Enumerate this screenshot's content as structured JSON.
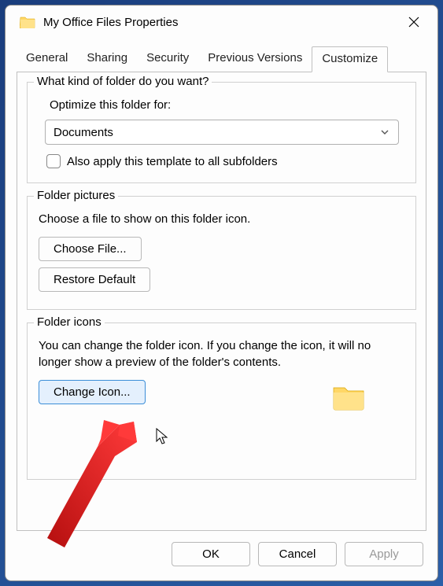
{
  "window": {
    "title": "My Office Files Properties"
  },
  "tabs": {
    "general": "General",
    "sharing": "Sharing",
    "security": "Security",
    "previous": "Previous Versions",
    "customize": "Customize"
  },
  "group_kind": {
    "legend": "What kind of folder do you want?",
    "optimize_label": "Optimize this folder for:",
    "selected": "Documents",
    "checkbox_label": "Also apply this template to all subfolders"
  },
  "group_pictures": {
    "legend": "Folder pictures",
    "desc": "Choose a file to show on this folder icon.",
    "choose_btn": "Choose File...",
    "restore_btn": "Restore Default"
  },
  "group_icons": {
    "legend": "Folder icons",
    "desc": "You can change the folder icon. If you change the icon, it will no longer show a preview of the folder's contents.",
    "change_btn": "Change Icon..."
  },
  "footer": {
    "ok": "OK",
    "cancel": "Cancel",
    "apply": "Apply"
  }
}
